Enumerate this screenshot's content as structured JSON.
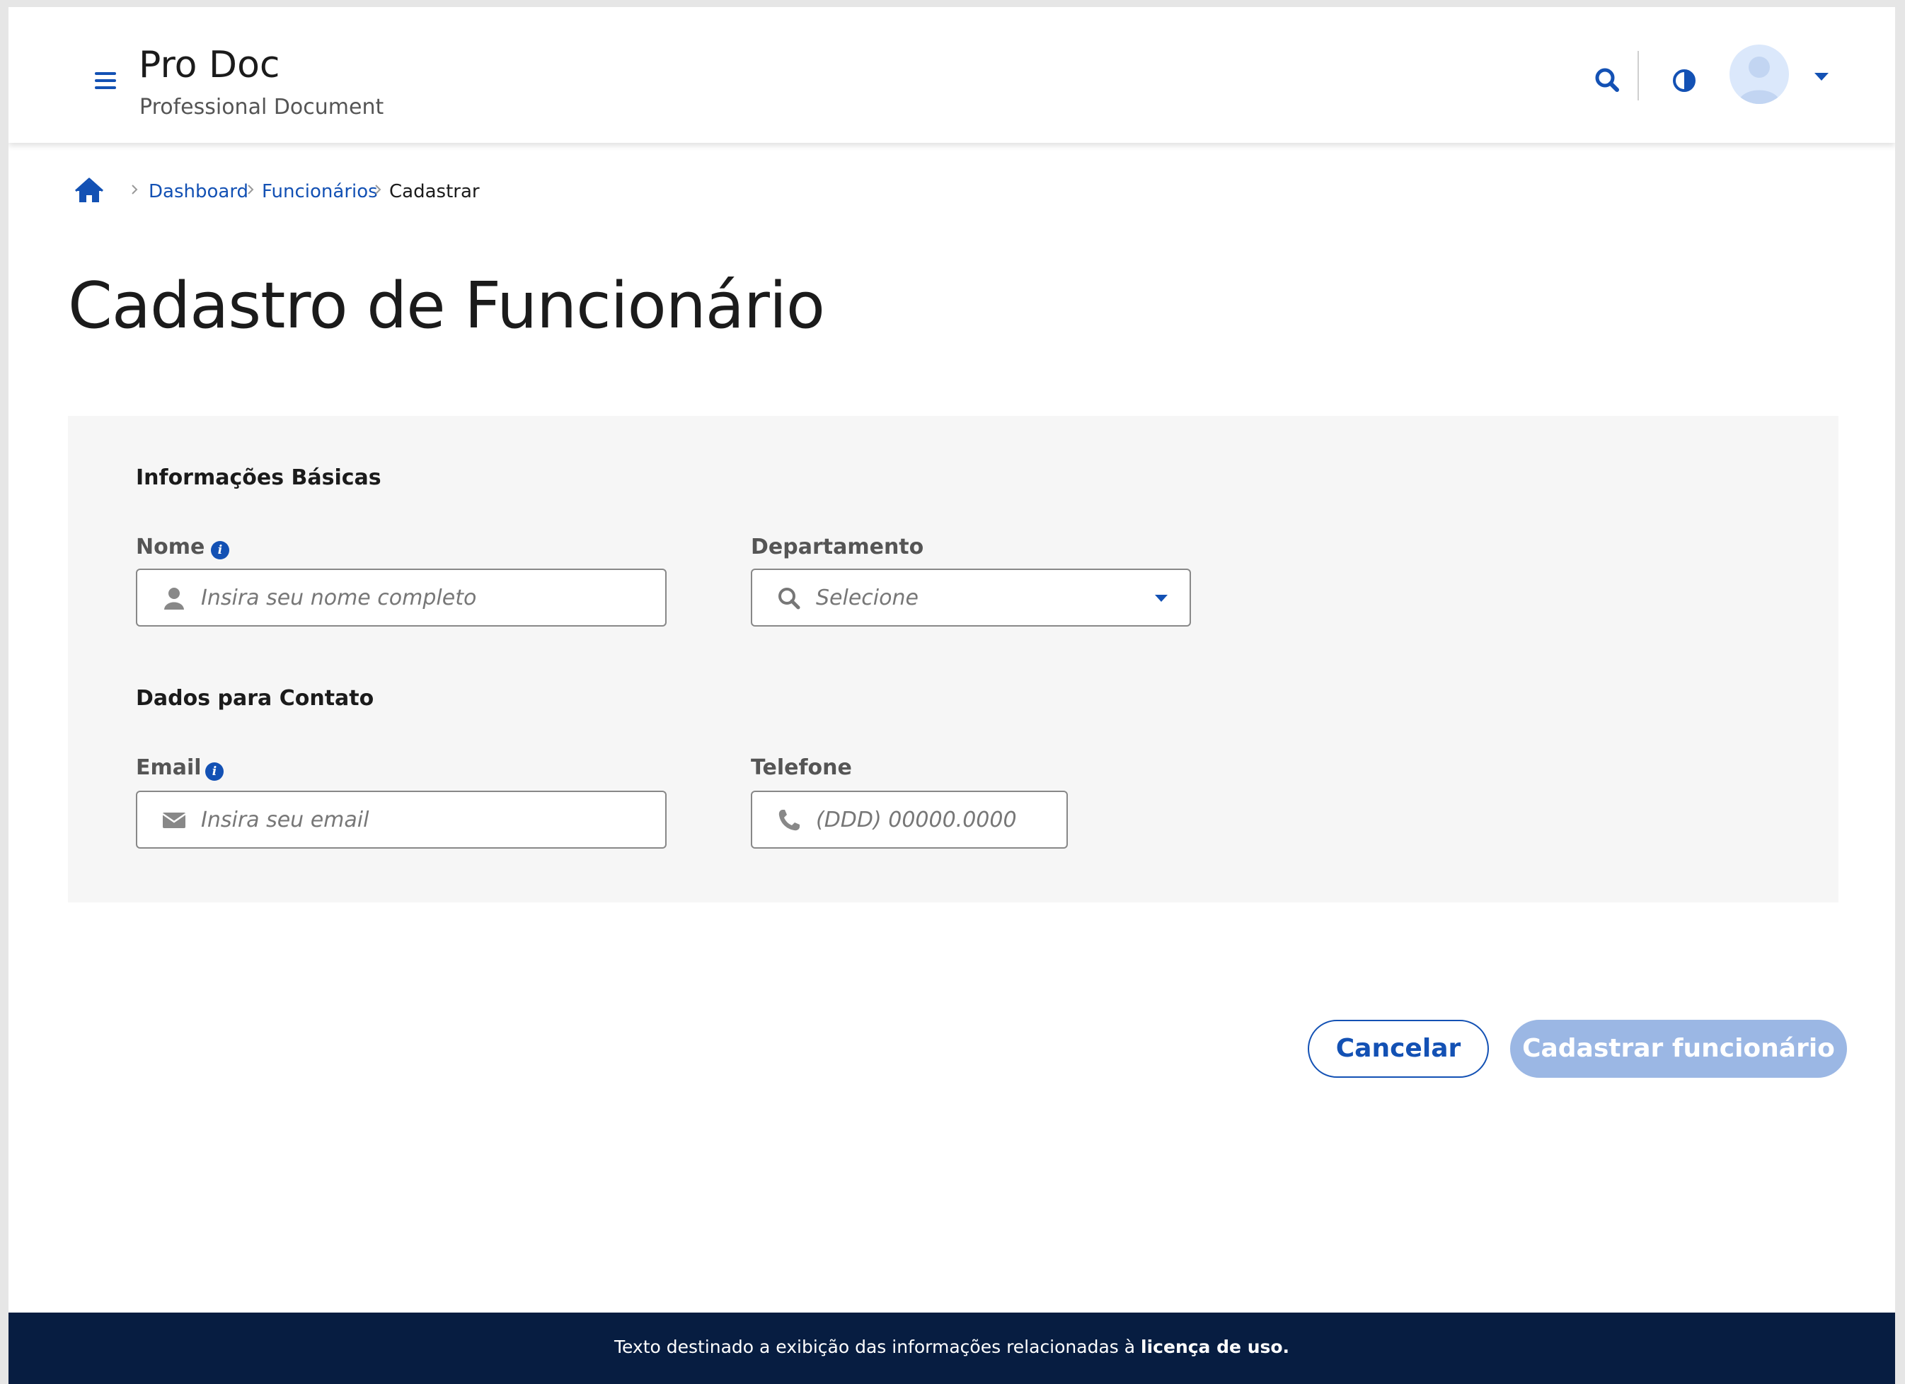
{
  "header": {
    "title": "Pro Doc",
    "subtitle": "Professional Document",
    "menu_icon": "hamburger-menu-icon",
    "search_icon": "search-icon",
    "contrast_icon": "contrast-icon",
    "avatar_icon": "user-avatar-icon",
    "avatar_menu_icon": "caret-down-icon"
  },
  "breadcrumb": {
    "home_icon": "home-icon",
    "items": [
      "Dashboard",
      "Funcionários",
      "Cadastrar"
    ]
  },
  "page": {
    "title": "Cadastro de Funcionário"
  },
  "form": {
    "basic_section": "Informações Básicas",
    "contact_section": "Dados para Contato",
    "name": {
      "label": "Nome",
      "placeholder": "Insira seu nome completo",
      "icon": "user-icon",
      "info_icon": "info-icon"
    },
    "department": {
      "label": "Departamento",
      "placeholder": "Selecione",
      "icon": "search-icon",
      "dropdown_icon": "caret-down-icon"
    },
    "email": {
      "label": "Email",
      "placeholder": "Insira seu email",
      "icon": "envelope-icon",
      "info_icon": "info-icon"
    },
    "phone": {
      "label": "Telefone",
      "placeholder": "(DDD) 00000.0000",
      "icon": "phone-icon"
    }
  },
  "actions": {
    "cancel": "Cancelar",
    "submit": "Cadastrar funcionário"
  },
  "footer": {
    "text": "Texto destinado a exibição das informações relacionadas à ",
    "link": "licença de uso."
  },
  "colors": {
    "primary": "#1351b4",
    "primary_disabled": "#9bb7e4",
    "footer_bg": "#071d41",
    "card_bg": "#f6f6f6"
  }
}
